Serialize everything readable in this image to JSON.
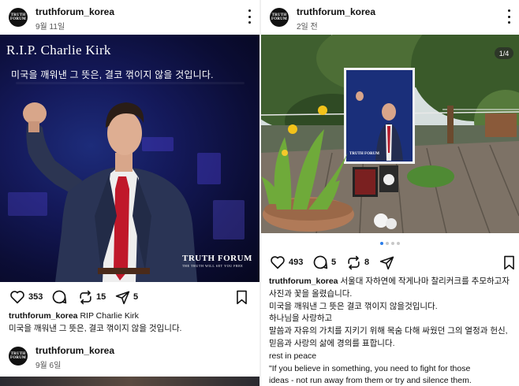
{
  "left_post": {
    "username": "truthforum_korea",
    "date": "9월 11일",
    "avatar_text_1": "TRUTH",
    "avatar_text_2": "FORUM",
    "image_title": "R.I.P. Charlie Kirk",
    "image_subtitle": "미국을 깨워낸 그 뜻은, 결코 꺾이지 않을 것입니다.",
    "logo_main": "TRUTH FORUM",
    "logo_tagline": "THE TRUTH WILL SET YOU FREE",
    "likes": "353",
    "reposts": "15",
    "shares": "5",
    "caption_user": "truthforum_korea",
    "caption_text": "RIP Charlie Kirk",
    "caption_line2": "미국을 깨워낸 그 뜻은, 결코 꺾이지 않을 것입니다."
  },
  "next_post": {
    "username": "truthforum_korea",
    "date": "9월 6일",
    "avatar_text_1": "TRUTH",
    "avatar_text_2": "FORUM"
  },
  "right_post": {
    "username": "truthforum_korea",
    "date": "2일 전",
    "avatar_text_1": "TRUTH",
    "avatar_text_2": "FORUM",
    "carousel_counter": "1/4",
    "carousel_current": 1,
    "carousel_total": 4,
    "poster_label": "TRUTH FORUM",
    "likes": "493",
    "comments": "5",
    "reposts": "8",
    "caption_user": "truthforum_korea",
    "caption_lines": [
      "서울대 자하연에 작게나마 찰리커크를 추모하고자",
      "사진과 꽃을 올렸습니다.",
      "미국을 깨워낸 그 뜻은 결코 꺾이지 않을것입니다.",
      "하나님을 사랑하고",
      "말씀과 자유의 가치를 지키기 위해 목숨 다해 싸웠던 그의 열정과 헌신,",
      "믿음과 사랑의 삶에 경의를 표합니다.",
      "rest in peace",
      "\"If you believe in something, you need to fight for those",
      "ideas - not run away from them or try and silence them."
    ]
  },
  "colors": {
    "accent_blue": "#2b7de9",
    "poster_bg": "#1a2f7a"
  },
  "icons": [
    "more-icon",
    "heart-icon",
    "comment-icon",
    "repost-icon",
    "share-icon",
    "bookmark-icon"
  ]
}
